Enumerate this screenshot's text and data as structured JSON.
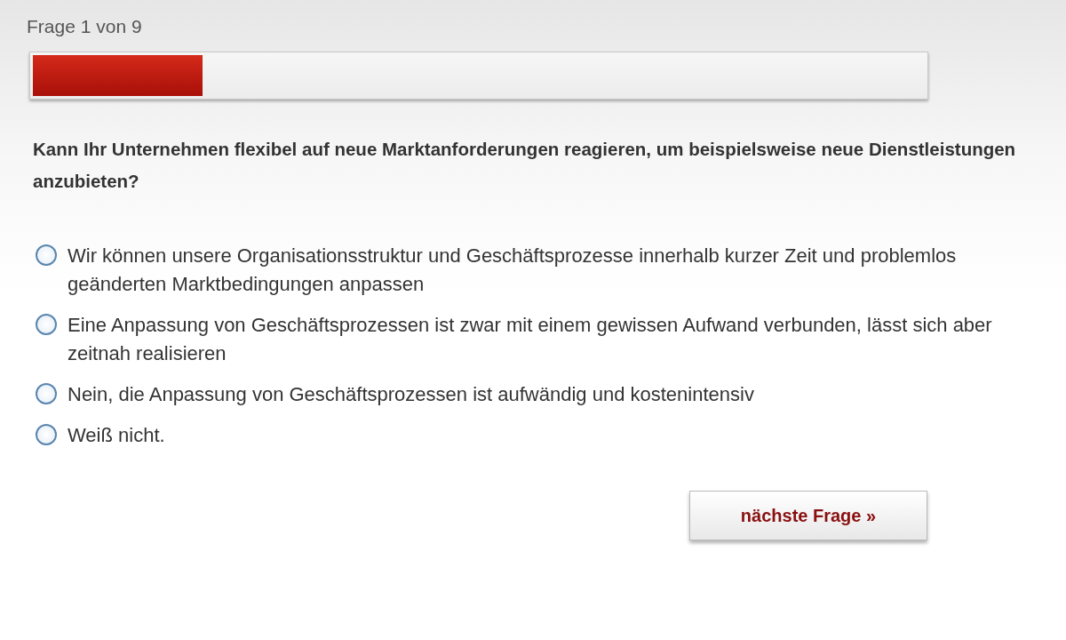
{
  "progress_label": "Frage 1 von 9",
  "progress": {
    "level": 0.19
  },
  "question": "Kann Ihr Unternehmen flexibel auf neue Marktanforderungen reagieren, um beispielsweise neue Dienstleistungen anzubieten?",
  "options": [
    {
      "label": "Wir können unsere Organisationsstruktur und Geschäftsprozesse innerhalb kurzer Zeit und problemlos geänderten Marktbedingungen anpassen",
      "selected": false
    },
    {
      "label": "Eine Anpassung von Geschäftsprozessen ist zwar mit einem gewissen Aufwand verbunden, lässt sich aber zeitnah realisieren",
      "selected": false
    },
    {
      "label": "Nein, die Anpassung von Geschäftsprozessen ist aufwändig und kostenintensiv",
      "selected": false
    },
    {
      "label": "Weiß nicht.",
      "selected": false
    }
  ],
  "next_button": "nächste Frage »"
}
